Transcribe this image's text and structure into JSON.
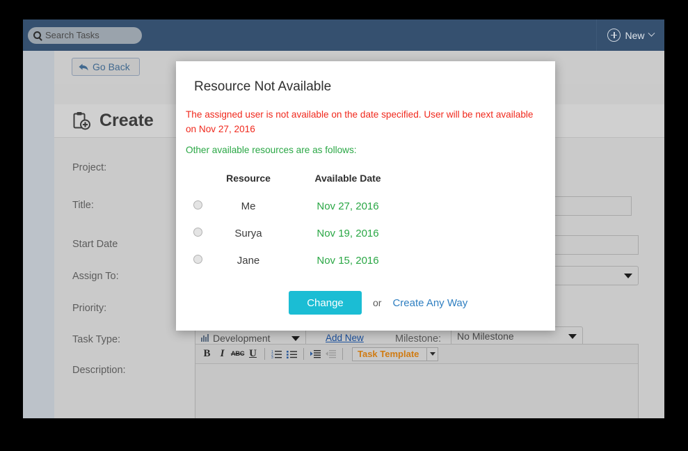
{
  "topbar": {
    "search_placeholder": "Search Tasks",
    "search_value": "",
    "search_icon": "search-icon",
    "new_label": "New",
    "new_icon": "plus-circle-icon",
    "new_chevron_icon": "chevron-down-icon"
  },
  "toolbar": {
    "go_back_label": "Go Back",
    "go_back_icon": "back-arrow-icon"
  },
  "page": {
    "title": "Create",
    "title_icon": "clipboard-plus-icon"
  },
  "form": {
    "labels": {
      "project": "Project:",
      "title": "Title:",
      "start_date": "Start Date",
      "assign_to": "Assign To:",
      "priority": "Priority:",
      "task_type": "Task Type:",
      "description": "Description:",
      "milestone": "Milestone:"
    },
    "values": {
      "project": "",
      "title": "",
      "start_date": "",
      "assign_to": "",
      "priority": "",
      "task_type": "Development",
      "milestone": "No Milestone"
    },
    "add_new_link": "Add New",
    "task_type_icon": "bar-chart-icon"
  },
  "editor": {
    "bold": "B",
    "italic": "I",
    "strikethrough": "ABC",
    "underline": "U",
    "ordered_list_icon": "ordered-list-icon",
    "unordered_list_icon": "unordered-list-icon",
    "indent_icon": "indent-icon",
    "outdent_icon": "outdent-icon",
    "template_label": "Task Template",
    "content": ""
  },
  "modal": {
    "title": "Resource Not Available",
    "error_message": "The assigned user is not available on the date specified. User will be next available on Nov 27, 2016",
    "info_message": "Other available resources are as follows:",
    "table": {
      "headers": [
        "Resource",
        "Available Date"
      ],
      "rows": [
        {
          "resource": "Me",
          "date": "Nov 27, 2016",
          "selected": false
        },
        {
          "resource": "Surya",
          "date": "Nov 19, 2016",
          "selected": false
        },
        {
          "resource": "Jane",
          "date": "Nov 15, 2016",
          "selected": false
        }
      ]
    },
    "change_label": "Change",
    "or_label": "or",
    "create_anyway_label": "Create Any Way"
  },
  "colors": {
    "topbar": "#35506f",
    "accent_button": "#1bbdd4",
    "error": "#f0291d",
    "success": "#2aa745",
    "link": "#2f7fc1"
  }
}
